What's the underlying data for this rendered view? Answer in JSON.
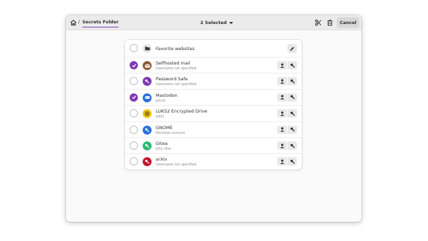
{
  "header": {
    "breadcrumb_current": "Secrets Folder",
    "breadcrumb_separator": "/",
    "selection_label": "2 Selected",
    "cancel_label": "Cancel"
  },
  "folder": {
    "title": "Favorite websites"
  },
  "accent_color": "#8138b3",
  "items": [
    {
      "title": "Selfhosted mail",
      "subtitle": "Username not specified",
      "checked": true,
      "icon": "mail-icon",
      "color": "#8d5a33"
    },
    {
      "title": "Password Safe",
      "subtitle": "Username not specified",
      "checked": false,
      "icon": "key-icon",
      "color": "#8138b3"
    },
    {
      "title": "Mastodon",
      "subtitle": "johnd",
      "checked": true,
      "icon": "gamepad-icon",
      "color": "#2a72d6"
    },
    {
      "title": "LUKS2 Encrypted Drive",
      "subtitle": "edd1",
      "checked": false,
      "icon": "drive-icon",
      "color": "#f2c318"
    },
    {
      "title": "GNOME",
      "subtitle": "Personal account",
      "checked": false,
      "icon": "key-icon",
      "color": "#2a72d6"
    },
    {
      "title": "Gitea",
      "subtitle": "John Doe",
      "checked": false,
      "icon": "key-icon",
      "color": "#2fb872"
    },
    {
      "title": "arXiv",
      "subtitle": "Username not specified",
      "checked": false,
      "icon": "key-icon",
      "color": "#c3162a"
    }
  ]
}
